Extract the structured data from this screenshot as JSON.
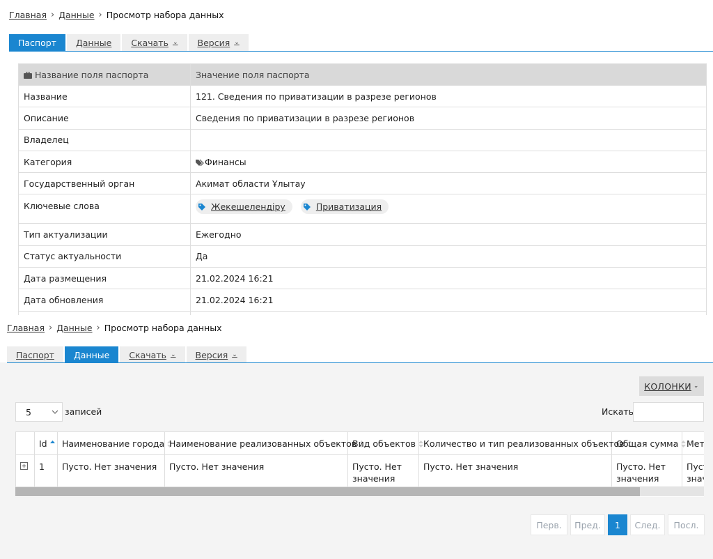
{
  "breadcrumb": {
    "home": "Главная",
    "data": "Данные",
    "current": "Просмотр набора данных"
  },
  "tabs": {
    "passport": "Паспорт",
    "data": "Данные",
    "download": "Скачать",
    "version": "Версия"
  },
  "passport_table": {
    "header_key": "Название поля паспорта",
    "header_value": "Значение поля паспорта",
    "rows": [
      {
        "key": "Название",
        "value": "121. Сведения по приватизации в разрезе регионов"
      },
      {
        "key": "Описание",
        "value": "Сведения по приватизации в разрезе регионов"
      },
      {
        "key": "Владелец",
        "value": ""
      },
      {
        "key": "Категория",
        "value": "Финансы"
      },
      {
        "key": "Государственный орган",
        "value": "Акимат области Ұлытау"
      },
      {
        "key": "Ключевые слова",
        "keywords": [
          "Жекешелендіру",
          "Приватизация"
        ]
      },
      {
        "key": "Тип актуализации",
        "value": "Ежегодно"
      },
      {
        "key": "Статус актуальности",
        "value": "Да"
      },
      {
        "key": "Дата размещения",
        "value": "21.02.2024 16:21"
      },
      {
        "key": "Дата обновления",
        "value": "21.02.2024 16:21"
      }
    ]
  },
  "data_view": {
    "columns_button": "КОЛОНКИ",
    "page_length": "5",
    "records_label": "записей",
    "search_label": "Искать:",
    "search_value": "",
    "grid": {
      "headers": [
        "Id",
        "Наименование города",
        "Наименование реализованных объектов",
        "Вид объектов",
        "Количество и тип реализованных объектов",
        "Общая сумма",
        "Мет"
      ],
      "row": [
        "1",
        "Пусто. Нет значения",
        "Пусто. Нет значения",
        "Пусто. Нет значения",
        "Пусто. Нет значения",
        "Пусто. Нет значения",
        "Пусто. Нет значения"
      ]
    },
    "pagination": {
      "first": "Перв.",
      "prev": "Пред.",
      "current": "1",
      "next": "След.",
      "last": "Посл."
    }
  },
  "colors": {
    "accent": "#1a86d0",
    "header_bg": "#d9d9d9",
    "tab_bg": "#eeeeee"
  },
  "icons": [
    "briefcase-icon",
    "tag-icon",
    "tags-icon",
    "chevron-down-icon",
    "sort-icon",
    "expand-row-icon"
  ]
}
